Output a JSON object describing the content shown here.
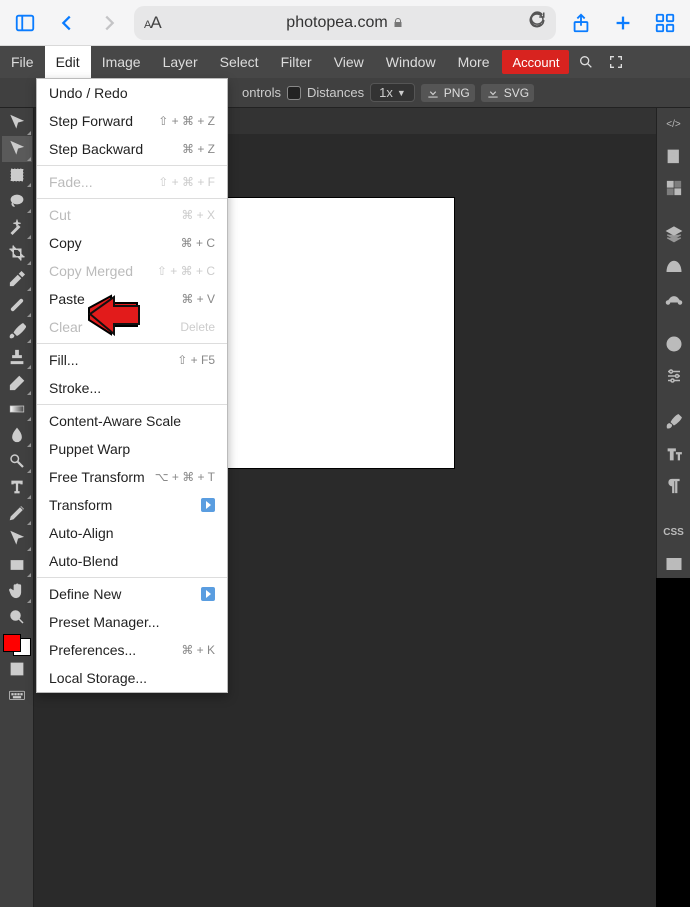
{
  "browser": {
    "url": "photopea.com",
    "text_size_label": "A"
  },
  "menubar": {
    "items": [
      "File",
      "Edit",
      "Image",
      "Layer",
      "Select",
      "Filter",
      "View",
      "Window",
      "More"
    ],
    "active_index": 1,
    "account_label": "Account"
  },
  "optbar": {
    "controls_label": "ontrols",
    "distances_label": "Distances",
    "zoom_label": "1x",
    "export_png": "PNG",
    "export_svg": "SVG"
  },
  "tab": {
    "close": "×"
  },
  "edit_menu": [
    {
      "label": "Undo / Redo",
      "shortcut": "",
      "type": "item"
    },
    {
      "label": "Step Forward",
      "shortcut": "⇧ + ⌘ + Z",
      "type": "item"
    },
    {
      "label": "Step Backward",
      "shortcut": "⌘ + Z",
      "type": "item"
    },
    {
      "type": "sep"
    },
    {
      "label": "Fade...",
      "shortcut": "⇧ + ⌘ + F",
      "type": "disabled"
    },
    {
      "type": "sep"
    },
    {
      "label": "Cut",
      "shortcut": "⌘ + X",
      "type": "disabled"
    },
    {
      "label": "Copy",
      "shortcut": "⌘ + C",
      "type": "item"
    },
    {
      "label": "Copy Merged",
      "shortcut": "⇧ + ⌘ + C",
      "type": "disabled"
    },
    {
      "label": "Paste",
      "shortcut": "⌘ + V",
      "type": "item"
    },
    {
      "label": "Clear",
      "shortcut": "Delete",
      "type": "disabled"
    },
    {
      "type": "sep"
    },
    {
      "label": "Fill...",
      "shortcut": "⇧ + F5",
      "type": "item"
    },
    {
      "label": "Stroke...",
      "shortcut": "",
      "type": "item"
    },
    {
      "type": "sep"
    },
    {
      "label": "Content-Aware Scale",
      "shortcut": "",
      "type": "item"
    },
    {
      "label": "Puppet Warp",
      "shortcut": "",
      "type": "item"
    },
    {
      "label": "Free Transform",
      "shortcut": "⌥ + ⌘ + T",
      "type": "item"
    },
    {
      "label": "Transform",
      "shortcut": "",
      "type": "play"
    },
    {
      "label": "Auto-Align",
      "shortcut": "",
      "type": "item"
    },
    {
      "label": "Auto-Blend",
      "shortcut": "",
      "type": "item"
    },
    {
      "type": "sep"
    },
    {
      "label": "Define New",
      "shortcut": "",
      "type": "play"
    },
    {
      "label": "Preset Manager...",
      "shortcut": "",
      "type": "item"
    },
    {
      "label": "Preferences...",
      "shortcut": "⌘ + K",
      "type": "item"
    },
    {
      "label": "Local Storage...",
      "shortcut": "",
      "type": "item"
    }
  ],
  "rpanel_css": "CSS"
}
